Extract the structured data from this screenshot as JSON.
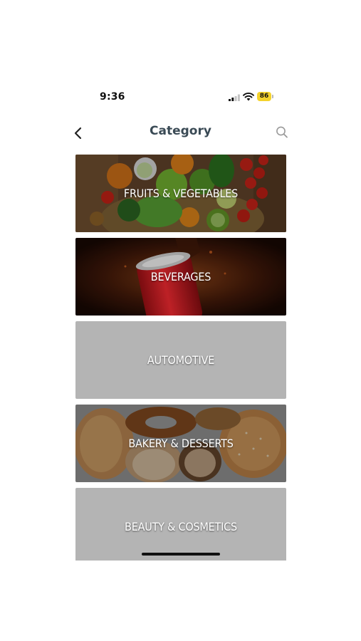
{
  "status_bar": {
    "time": "9:36",
    "battery": "86"
  },
  "header": {
    "title": "Category"
  },
  "categories": [
    {
      "label": "FRUITS & VEGETABLES"
    },
    {
      "label": "BEVERAGES"
    },
    {
      "label": "AUTOMOTIVE"
    },
    {
      "label": "BAKERY & DESSERTS"
    },
    {
      "label": "BEAUTY & COSMETICS"
    }
  ],
  "colors": {
    "title": "#3a4a55",
    "placeholder_card": "#b4b4b4",
    "battery": "#f4d22c"
  }
}
